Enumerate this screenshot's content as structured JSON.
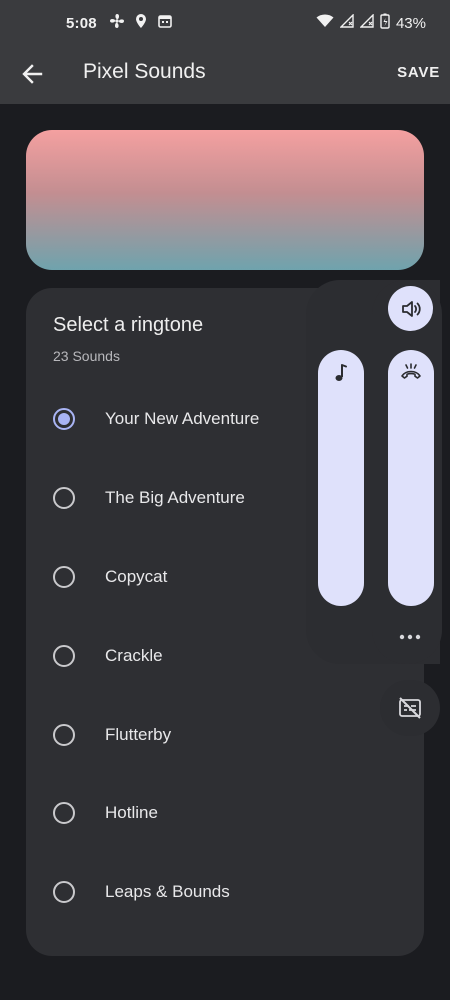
{
  "status_bar": {
    "time": "5:08",
    "battery": "43%",
    "icons": [
      "fan-icon",
      "location-icon",
      "calendar-icon",
      "wifi-icon",
      "signal-icon",
      "signal-icon",
      "battery-icon"
    ]
  },
  "app_bar": {
    "title": "Pixel Sounds",
    "save_label": "SAVE",
    "back_icon": "arrow-back-icon"
  },
  "ringtones": {
    "title": "Select a ringtone",
    "count_label": "23 Sounds",
    "items": [
      {
        "label": "Your New Adventure",
        "selected": true
      },
      {
        "label": "The Big Adventure",
        "selected": false
      },
      {
        "label": "Copycat",
        "selected": false
      },
      {
        "label": "Crackle",
        "selected": false
      },
      {
        "label": "Flutterby",
        "selected": false
      },
      {
        "label": "Hotline",
        "selected": false
      },
      {
        "label": "Leaps & Bounds",
        "selected": false
      }
    ]
  },
  "volume_panel": {
    "speaker_icon": "volume-icon",
    "sliders": [
      {
        "name": "ring",
        "icon": "music-note-icon",
        "level": 1.0
      },
      {
        "name": "call",
        "icon": "phone-hangup-icon",
        "level": 1.0
      }
    ],
    "more_icon": "more-horiz-icon",
    "caption_icon": "captions-off-icon"
  },
  "colors": {
    "background": "#1b1c20",
    "bar": "#3a3b3e",
    "card": "#2e2f33",
    "accent": "#a9b4f4",
    "slider": "#dfe1fb",
    "gradient_top": "#f4a0a0",
    "gradient_bottom": "#6fa3ad"
  }
}
